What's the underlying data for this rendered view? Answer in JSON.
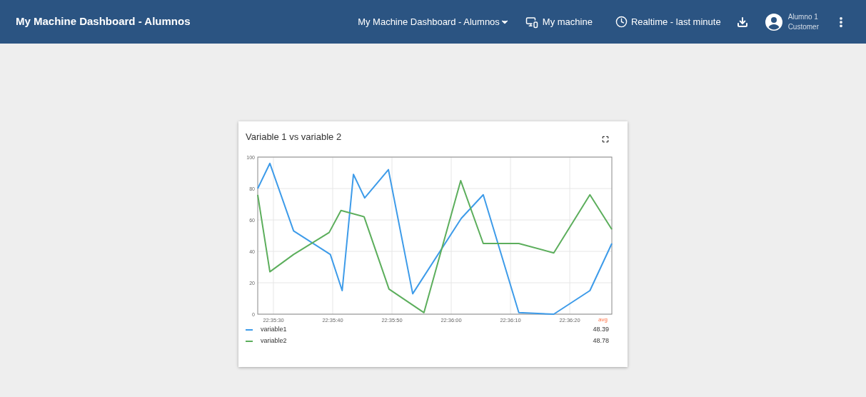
{
  "header": {
    "title": "My Machine Dashboard - Alumnos",
    "dashboard_menu": "My Machine Dashboard - Alumnos",
    "device": "My machine",
    "time_range": "Realtime - last minute",
    "user": {
      "name": "Alumno 1",
      "role": "Customer"
    }
  },
  "widget": {
    "title": "Variable 1 vs variable 2",
    "chart_data": {
      "type": "line",
      "grid": true,
      "xlim": [
        81327.35,
        81387.1
      ],
      "ylim": [
        0,
        100
      ],
      "xticks": [
        {
          "value": 81330,
          "label": "22:35:30"
        },
        {
          "value": 81340,
          "label": "22:35:40"
        },
        {
          "value": 81350,
          "label": "22:35:50"
        },
        {
          "value": 81360,
          "label": "22:36:00"
        },
        {
          "value": 81370,
          "label": "22:36:10"
        },
        {
          "value": 81380,
          "label": "22:36:20"
        }
      ],
      "yticks": [
        0,
        20,
        40,
        60,
        80,
        100
      ],
      "series": [
        {
          "name": "variable1",
          "color": "#3d9be9",
          "x": [
            81327.35,
            81329.4,
            81333.4,
            81339.6,
            81341.6,
            81343.5,
            81345.4,
            81349.4,
            81353.5,
            81361.7,
            81365.4,
            81371.4,
            81377.3,
            81383.4,
            81387.1
          ],
          "values": [
            80,
            96,
            53,
            38,
            15,
            89,
            74,
            92,
            13,
            61,
            76,
            1,
            0,
            15,
            45
          ]
        },
        {
          "name": "variable2",
          "color": "#5cae5c",
          "x": [
            81327.35,
            81329.4,
            81333.4,
            81339.4,
            81341.4,
            81345.3,
            81349.5,
            81355.4,
            81361.6,
            81365.4,
            81371.4,
            81377.3,
            81383.4,
            81387.1
          ],
          "values": [
            76,
            27,
            38,
            52,
            66,
            62,
            16,
            1,
            85,
            45,
            45,
            39,
            76,
            54
          ]
        }
      ]
    },
    "legend": {
      "header": "avg",
      "values": [
        "48.39",
        "48.78"
      ]
    }
  }
}
